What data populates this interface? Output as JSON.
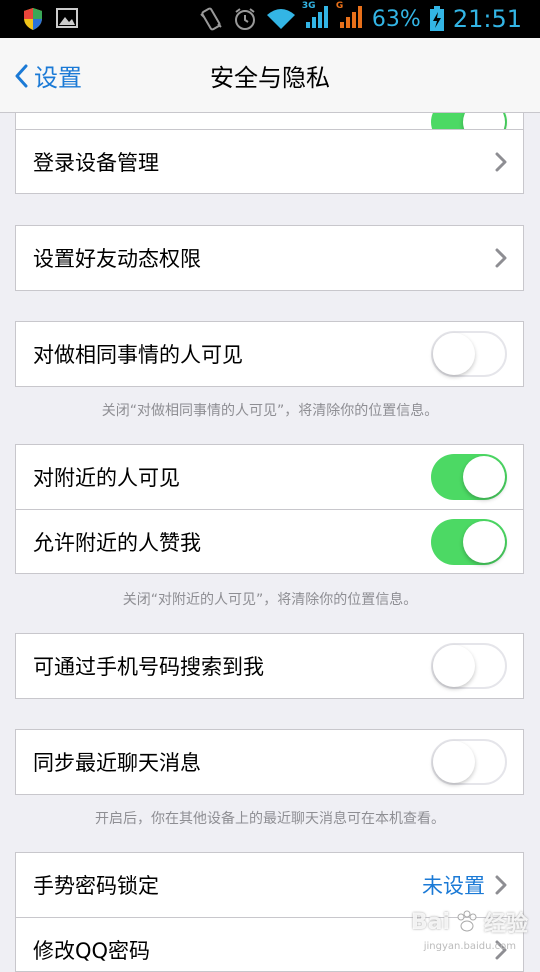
{
  "status_bar": {
    "network_3g": "3G",
    "network_g": "G",
    "battery": "63%",
    "time": "21:51"
  },
  "nav": {
    "back_label": "设置",
    "title": "安全与隐私"
  },
  "items": {
    "device_mgmt": "登录设备管理",
    "friend_feed_permission": "设置好友动态权限",
    "same_activity_visible": "对做相同事情的人可见",
    "same_activity_note": "关闭“对做相同事情的人可见”，将清除你的位置信息。",
    "nearby_visible": "对附近的人可见",
    "nearby_like": "允许附近的人赞我",
    "nearby_note": "关闭“对附近的人可见”，将清除你的位置信息。",
    "phone_search": "可通过手机号码搜索到我",
    "sync_chat": "同步最近聊天消息",
    "sync_note": "开启后，你在其他设备上的最近聊天消息可在本机查看。",
    "gesture_lock": "手势密码锁定",
    "gesture_value": "未设置",
    "change_password": "修改QQ密码"
  },
  "toggles": {
    "top_partial": true,
    "same_activity_visible": false,
    "nearby_visible": true,
    "nearby_like": true,
    "phone_search": false,
    "sync_chat": false
  },
  "colors": {
    "accent": "#1b7ad6",
    "toggle_on": "#4cd964",
    "statusbar_text": "#33b5e5"
  },
  "watermark": {
    "brand": "Bai",
    "brand_suffix": "经验",
    "sub": "jingyan.baidu.com"
  }
}
